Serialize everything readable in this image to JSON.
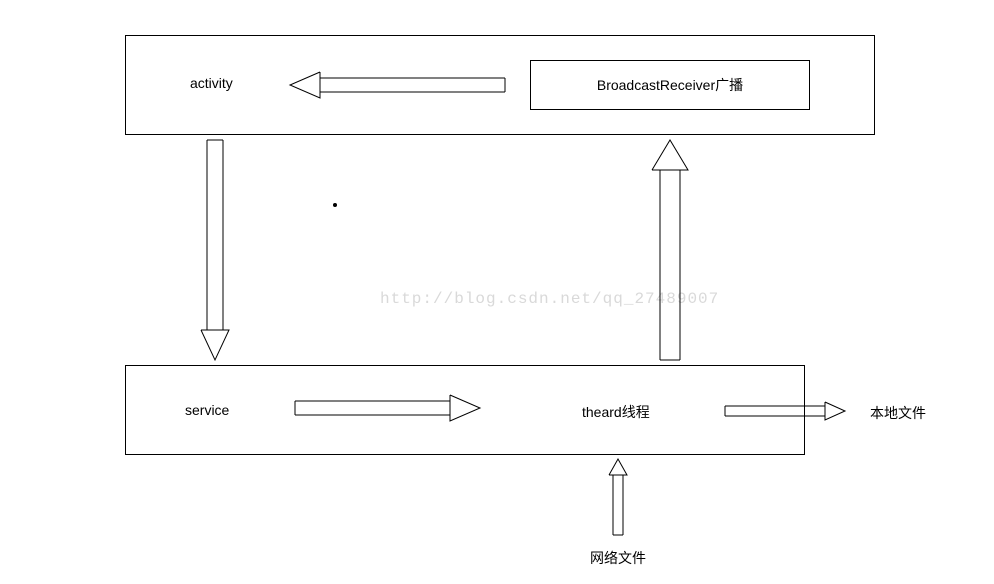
{
  "diagram": {
    "top_box": {
      "activity_label": "activity",
      "broadcast_label": "BroadcastReceiver广播"
    },
    "bottom_box": {
      "service_label": "service",
      "thread_label": "theard线程"
    },
    "external": {
      "local_file_label": "本地文件",
      "network_file_label": "网络文件"
    },
    "watermark": "http://blog.csdn.net/qq_27489007"
  }
}
